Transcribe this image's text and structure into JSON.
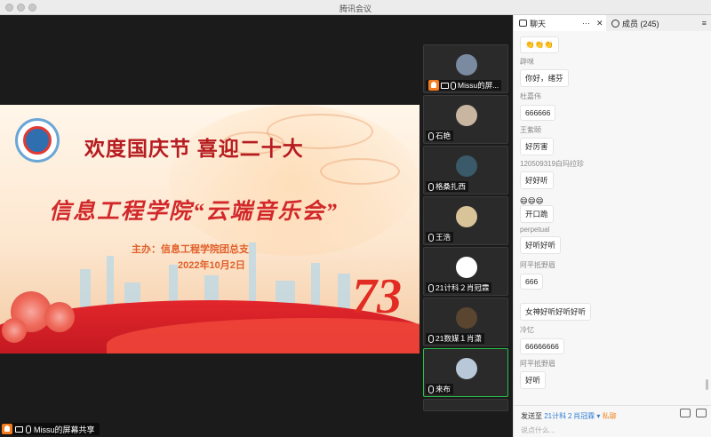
{
  "window": {
    "title": "腾讯会议"
  },
  "slide": {
    "title": "欢度国庆节  喜迎二十大",
    "subtitle": "信息工程学院“云端音乐会”",
    "host": "主办：信息工程学院团总支",
    "date": "2022年10月2日",
    "badge": "73"
  },
  "sharer": {
    "label": "Missu的屏幕共享"
  },
  "tiles": [
    {
      "name": "Missu的屏...",
      "active": false,
      "avatar_color": "#7a8aa0"
    },
    {
      "name": "石艳",
      "active": false,
      "avatar_color": "#c9b6a0"
    },
    {
      "name": "格桑扎西",
      "active": false,
      "avatar_color": "#3a5a6a"
    },
    {
      "name": "王浩",
      "active": false,
      "avatar_color": "#d9c49a"
    },
    {
      "name": "21计科２肖冠霖",
      "active": false,
      "avatar_color": "#111111"
    },
    {
      "name": "21数媒１肖潇",
      "active": false,
      "avatar_color": "#5a4630"
    },
    {
      "name": "来布",
      "active": true,
      "avatar_color": "#b8c8d8"
    }
  ],
  "panel": {
    "chat_tab": "聊天",
    "members_tab": "成员 (245)",
    "more": "···",
    "close": "✕",
    "menu": "≡"
  },
  "messages": [
    {
      "who": "",
      "text": "👏👏👏"
    },
    {
      "who": "辟咪",
      "text": "你好，绪芬"
    },
    {
      "who": "杜嘉伟",
      "text": "666666"
    },
    {
      "who": "王紫颐",
      "text": "好厉害"
    },
    {
      "who": "120509319白玛拉珍",
      "text": "好好听"
    },
    {
      "who": "",
      "text": "😄😄😄"
    },
    {
      "who": "",
      "text": "开口跪"
    },
    {
      "who": "perpetual",
      "text": "好听好听"
    },
    {
      "who": "阿平抵野眉",
      "text": "666"
    },
    {
      "who": "",
      "text": "女神好听好听好听"
    },
    {
      "who": "冷忆",
      "text": "66666666"
    },
    {
      "who": "阿平抵野眉",
      "text": "好听"
    }
  ],
  "footer": {
    "send_to": "发送至",
    "recipient": "21计科２肖冠霖",
    "private": "私聊",
    "placeholder": "说点什么..."
  }
}
